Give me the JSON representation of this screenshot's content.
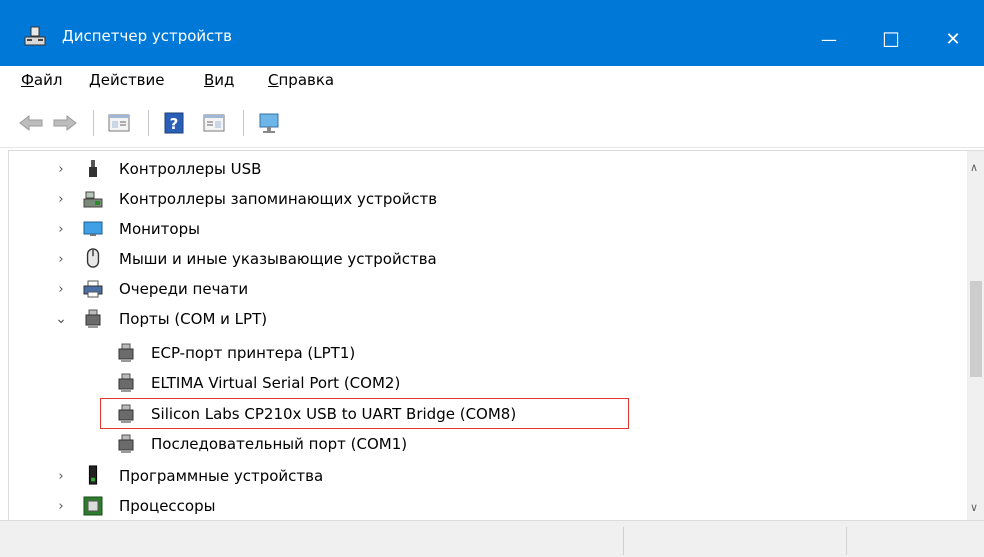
{
  "window": {
    "title": "Диспетчер устройств",
    "minimize_glyph": "—",
    "maximize_glyph": "☐",
    "close_glyph": "✕"
  },
  "menu": {
    "items": [
      {
        "label_hotkey": "Ф",
        "label_rest": "айл"
      },
      {
        "label_hotkey": "Д",
        "label_rest": "ействие"
      },
      {
        "label_hotkey": "В",
        "label_rest": "ид"
      },
      {
        "label_hotkey": "С",
        "label_rest": "правка"
      }
    ]
  },
  "toolbar": {
    "buttons": [
      "back-icon",
      "forward-icon",
      "properties-icon",
      "help-icon",
      "show-hidden-icon",
      "monitor-scan-icon"
    ]
  },
  "tree": {
    "rows": [
      {
        "label": "Контроллеры USB",
        "icon": "usb-icon",
        "expanded": false,
        "level": 0
      },
      {
        "label": "Контроллеры запоминающих устройств",
        "icon": "storage-controller-icon",
        "expanded": false,
        "level": 0
      },
      {
        "label": "Мониторы",
        "icon": "monitor-icon",
        "expanded": false,
        "level": 0
      },
      {
        "label": "Мыши и иные указывающие устройства",
        "icon": "mouse-icon",
        "expanded": false,
        "level": 0
      },
      {
        "label": "Очереди печати",
        "icon": "printer-icon",
        "expanded": false,
        "level": 0
      },
      {
        "label": "Порты (COM и LPT)",
        "icon": "port-icon",
        "expanded": true,
        "level": 0
      },
      {
        "label": "ECP-порт принтера (LPT1)",
        "icon": "port-icon",
        "level": 1
      },
      {
        "label": "ELTIMA Virtual Serial Port (COM2)",
        "icon": "port-icon",
        "level": 1
      },
      {
        "label": "Silicon Labs CP210x USB to UART Bridge (COM8)",
        "icon": "port-icon",
        "level": 1,
        "highlighted": true
      },
      {
        "label": "Последовательный порт (COM1)",
        "icon": "port-icon",
        "level": 1
      },
      {
        "label": "Программные устройства",
        "icon": "software-device-icon",
        "expanded": false,
        "level": 0
      },
      {
        "label": "Процессоры",
        "icon": "processor-icon",
        "expanded": false,
        "level": 0
      }
    ]
  },
  "colors": {
    "titlebar": "#0078d7",
    "highlight_border": "#e0362e"
  }
}
